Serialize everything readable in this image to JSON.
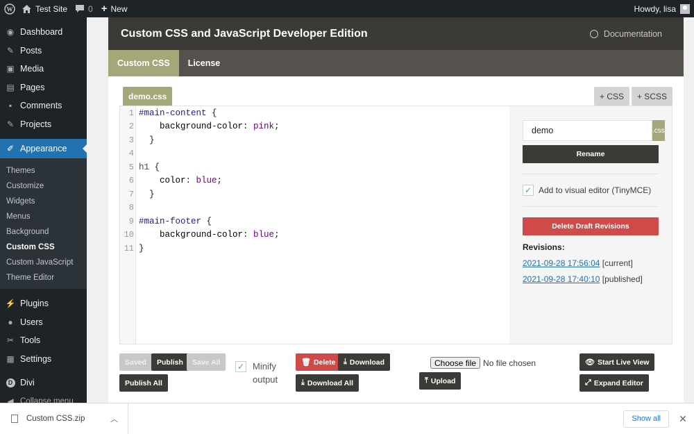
{
  "adminbar": {
    "site_name": "Test Site",
    "comments_count": "0",
    "new_label": "New",
    "howdy": "Howdy, lisa"
  },
  "sidebar": {
    "items_top": [
      {
        "label": "Dashboard",
        "icon": "dashboard-icon",
        "glyph": "◉"
      },
      {
        "label": "Posts",
        "icon": "pushpin-icon",
        "glyph": "✎"
      },
      {
        "label": "Media",
        "icon": "media-icon",
        "glyph": "▣"
      },
      {
        "label": "Pages",
        "icon": "pages-icon",
        "glyph": "▤"
      },
      {
        "label": "Comments",
        "icon": "comments-icon",
        "glyph": "▪"
      },
      {
        "label": "Projects",
        "icon": "pushpin-icon",
        "glyph": "✎"
      }
    ],
    "active": {
      "label": "Appearance",
      "icon": "brush-icon",
      "glyph": "✐"
    },
    "submenu": [
      "Themes",
      "Customize",
      "Widgets",
      "Menus",
      "Background",
      "Custom CSS",
      "Custom JavaScript",
      "Theme Editor"
    ],
    "submenu_current": "Custom CSS",
    "items_bottom": [
      {
        "label": "Plugins",
        "icon": "plugins-icon",
        "glyph": "⚡"
      },
      {
        "label": "Users",
        "icon": "users-icon",
        "glyph": "●"
      },
      {
        "label": "Tools",
        "icon": "tools-icon",
        "glyph": "✂"
      },
      {
        "label": "Settings",
        "icon": "settings-icon",
        "glyph": "▦"
      }
    ],
    "divi": {
      "label": "Divi",
      "icon": "divi-icon",
      "glyph": "D"
    },
    "collapse": "Collapse menu"
  },
  "plugin": {
    "title": "Custom CSS and JavaScript Developer Edition",
    "doc_label": "Documentation",
    "tabs": [
      "Custom CSS",
      "License"
    ],
    "active_tab": "Custom CSS"
  },
  "editor": {
    "file_tab": "demo.css",
    "add_css": "+ CSS",
    "add_scss": "+ SCSS",
    "lines": [
      [
        {
          "t": "#main-content",
          "c": "sel"
        },
        {
          "t": " {",
          "c": ""
        }
      ],
      [
        {
          "t": "    background-color",
          "c": "prop"
        },
        {
          "t": ": ",
          "c": ""
        },
        {
          "t": "pink",
          "c": "val"
        },
        {
          "t": ";",
          "c": ""
        }
      ],
      [
        {
          "t": "  }",
          "c": ""
        }
      ],
      [],
      [
        {
          "t": "h1",
          "c": "tag"
        },
        {
          "t": " {",
          "c": ""
        }
      ],
      [
        {
          "t": "    color",
          "c": "prop"
        },
        {
          "t": ": ",
          "c": ""
        },
        {
          "t": "blue",
          "c": "val"
        },
        {
          "t": ";",
          "c": ""
        }
      ],
      [
        {
          "t": "  }",
          "c": ""
        }
      ],
      [],
      [
        {
          "t": "#main-footer",
          "c": "sel"
        },
        {
          "t": " {",
          "c": ""
        }
      ],
      [
        {
          "t": "    background-color",
          "c": "prop"
        },
        {
          "t": ": ",
          "c": ""
        },
        {
          "t": "blue",
          "c": "val"
        },
        {
          "t": ";",
          "c": ""
        }
      ],
      [
        {
          "t": "}",
          "c": ""
        }
      ]
    ]
  },
  "side": {
    "file_name": "demo",
    "ext": ".css",
    "rename_label": "Rename",
    "visual_editor_label": "Add to visual editor (TinyMCE)",
    "delete_drafts_label": "Delete Draft Revisions",
    "revisions_title": "Revisions:",
    "revisions": [
      {
        "date": "2021-09-28 17:56:04",
        "tag": "[current]"
      },
      {
        "date": "2021-09-28 17:40:10",
        "tag": "[published]"
      }
    ]
  },
  "toolbar": {
    "saved": "Saved",
    "publish": "Publish",
    "save_all": "Save All",
    "publish_all": "Publish All",
    "minify_label": "Minify output",
    "delete": "Delete",
    "download": "Download",
    "download_all": "Download All",
    "choose_file": "Choose file",
    "no_file": "No file chosen",
    "upload": "Upload",
    "start_live": "Start Live View",
    "expand": "Expand Editor"
  },
  "download_bar": {
    "file_name": "Custom CSS.zip",
    "show_all": "Show all"
  },
  "colors": {
    "accent_olive": "#a4a878",
    "header_dark": "#3c3a36",
    "admin_blue": "#2271b1",
    "danger_red": "#d04a4a"
  }
}
